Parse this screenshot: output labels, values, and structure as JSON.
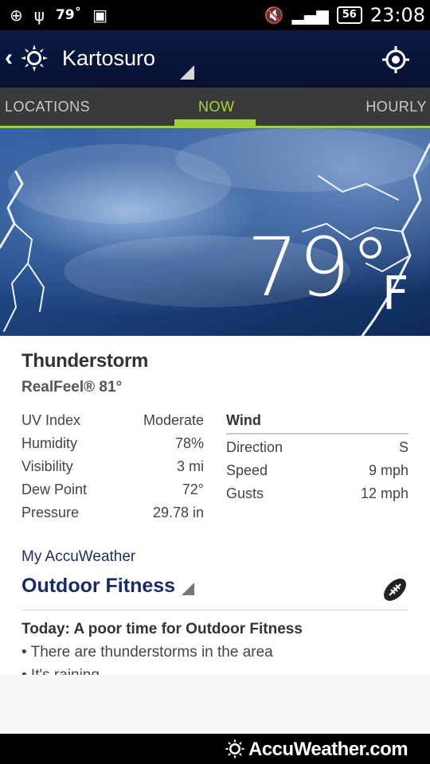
{
  "statusbar": {
    "left_icons": [
      "bbm-icon",
      "usb-icon"
    ],
    "temp": "79˚",
    "battery": "56",
    "time": "23:08"
  },
  "header": {
    "location": "Kartosuro"
  },
  "tabs": [
    {
      "label": "LOCATIONS"
    },
    {
      "label": "NOW"
    },
    {
      "label": "HOURLY"
    }
  ],
  "hero": {
    "temperature": "79°",
    "unit": "F"
  },
  "current": {
    "condition": "Thunderstorm",
    "realfeel": "RealFeel® 81°",
    "details": [
      {
        "label": "UV Index",
        "value": "Moderate"
      },
      {
        "label": "Humidity",
        "value": "78%"
      },
      {
        "label": "Visibility",
        "value": "3 mi"
      },
      {
        "label": "Dew Point",
        "value": "72°"
      },
      {
        "label": "Pressure",
        "value": "29.78 in"
      }
    ],
    "wind": {
      "title": "Wind",
      "rows": [
        {
          "label": "Direction",
          "value": "S"
        },
        {
          "label": "Speed",
          "value": "9 mph"
        },
        {
          "label": "Gusts",
          "value": "12 mph"
        }
      ]
    }
  },
  "myaccuweather": {
    "label": "My AccuWeather",
    "activity": "Outdoor Fitness",
    "today": "Today: A poor time for Outdoor Fitness",
    "bullets": [
      "• There are thunderstorms in the area",
      "• It's raining"
    ]
  },
  "footer": {
    "brand": "AccuWeather.com"
  }
}
